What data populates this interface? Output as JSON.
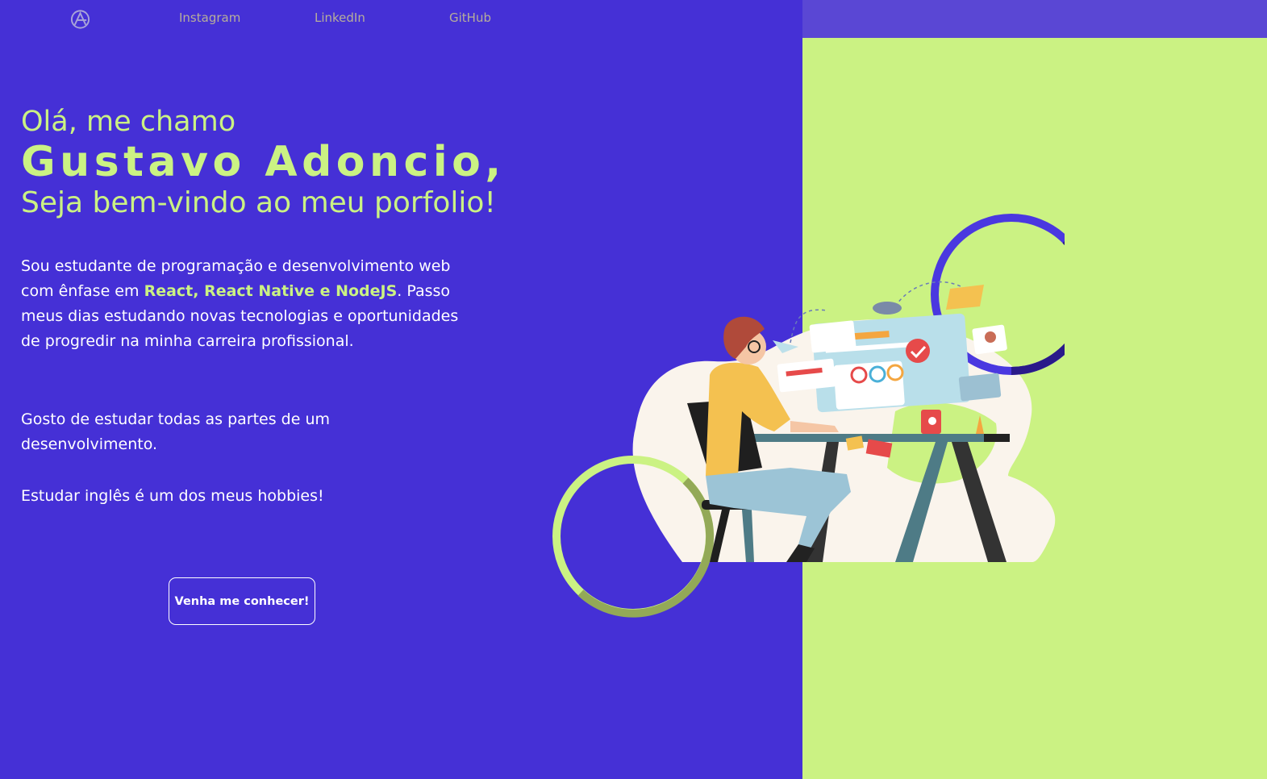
{
  "nav": {
    "logo_icon": "logo-icon",
    "links": [
      "Instagram",
      "LinkedIn",
      "GitHub"
    ]
  },
  "hero": {
    "greeting": "Olá, me chamo",
    "name": "Gustavo Adoncio,",
    "welcome": "Seja bem-vindo ao meu porfolio!",
    "about_before": "Sou estudante de programação e desenvolvimento web com ênfase em ",
    "about_highlight": "React, React Native e NodeJS",
    "about_after": ". Passo meus dias estudando novas tecnologias e oportunidades de progredir na minha carreira profissional.",
    "paragraph2": "Gosto de estudar todas as partes de um desenvolvimento.",
    "paragraph3": "Estudar inglês é um dos meus hobbies!",
    "cta_label": "Venha me conhecer!"
  },
  "colors": {
    "primary": "#4530d6",
    "accent": "#cbf283",
    "nav_right": "#5a47d4",
    "nav_link": "#b7ae9b"
  },
  "illustration": {
    "icon": "developer-at-desk-illustration"
  }
}
